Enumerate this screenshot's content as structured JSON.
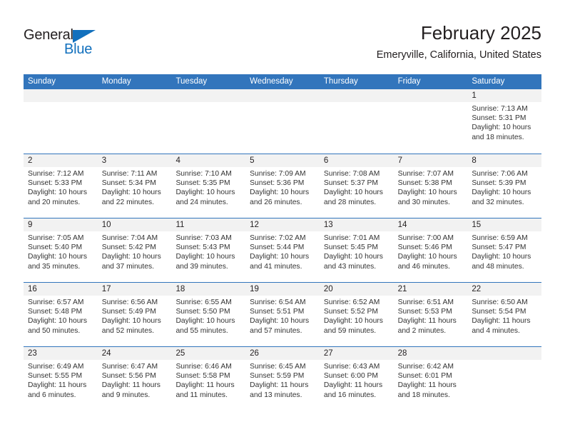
{
  "brand": {
    "name_part1": "General",
    "name_part2": "Blue",
    "triangle_color": "#1270bd"
  },
  "header": {
    "title": "February 2025",
    "subtitle": "Emeryville, California, United States"
  },
  "theme": {
    "header_blue": "#3275bc",
    "day_band_gray": "#f2f2f2",
    "text_color": "#231f20"
  },
  "weekdays": [
    "Sunday",
    "Monday",
    "Tuesday",
    "Wednesday",
    "Thursday",
    "Friday",
    "Saturday"
  ],
  "weeks": [
    [
      {
        "day": "",
        "sunrise": "",
        "sunset": "",
        "daylight": "",
        "empty": true
      },
      {
        "day": "",
        "sunrise": "",
        "sunset": "",
        "daylight": "",
        "empty": true
      },
      {
        "day": "",
        "sunrise": "",
        "sunset": "",
        "daylight": "",
        "empty": true
      },
      {
        "day": "",
        "sunrise": "",
        "sunset": "",
        "daylight": "",
        "empty": true
      },
      {
        "day": "",
        "sunrise": "",
        "sunset": "",
        "daylight": "",
        "empty": true
      },
      {
        "day": "",
        "sunrise": "",
        "sunset": "",
        "daylight": "",
        "empty": true
      },
      {
        "day": "1",
        "sunrise": "Sunrise: 7:13 AM",
        "sunset": "Sunset: 5:31 PM",
        "daylight": "Daylight: 10 hours and 18 minutes.",
        "empty": false
      }
    ],
    [
      {
        "day": "2",
        "sunrise": "Sunrise: 7:12 AM",
        "sunset": "Sunset: 5:33 PM",
        "daylight": "Daylight: 10 hours and 20 minutes.",
        "empty": false
      },
      {
        "day": "3",
        "sunrise": "Sunrise: 7:11 AM",
        "sunset": "Sunset: 5:34 PM",
        "daylight": "Daylight: 10 hours and 22 minutes.",
        "empty": false
      },
      {
        "day": "4",
        "sunrise": "Sunrise: 7:10 AM",
        "sunset": "Sunset: 5:35 PM",
        "daylight": "Daylight: 10 hours and 24 minutes.",
        "empty": false
      },
      {
        "day": "5",
        "sunrise": "Sunrise: 7:09 AM",
        "sunset": "Sunset: 5:36 PM",
        "daylight": "Daylight: 10 hours and 26 minutes.",
        "empty": false
      },
      {
        "day": "6",
        "sunrise": "Sunrise: 7:08 AM",
        "sunset": "Sunset: 5:37 PM",
        "daylight": "Daylight: 10 hours and 28 minutes.",
        "empty": false
      },
      {
        "day": "7",
        "sunrise": "Sunrise: 7:07 AM",
        "sunset": "Sunset: 5:38 PM",
        "daylight": "Daylight: 10 hours and 30 minutes.",
        "empty": false
      },
      {
        "day": "8",
        "sunrise": "Sunrise: 7:06 AM",
        "sunset": "Sunset: 5:39 PM",
        "daylight": "Daylight: 10 hours and 32 minutes.",
        "empty": false
      }
    ],
    [
      {
        "day": "9",
        "sunrise": "Sunrise: 7:05 AM",
        "sunset": "Sunset: 5:40 PM",
        "daylight": "Daylight: 10 hours and 35 minutes.",
        "empty": false
      },
      {
        "day": "10",
        "sunrise": "Sunrise: 7:04 AM",
        "sunset": "Sunset: 5:42 PM",
        "daylight": "Daylight: 10 hours and 37 minutes.",
        "empty": false
      },
      {
        "day": "11",
        "sunrise": "Sunrise: 7:03 AM",
        "sunset": "Sunset: 5:43 PM",
        "daylight": "Daylight: 10 hours and 39 minutes.",
        "empty": false
      },
      {
        "day": "12",
        "sunrise": "Sunrise: 7:02 AM",
        "sunset": "Sunset: 5:44 PM",
        "daylight": "Daylight: 10 hours and 41 minutes.",
        "empty": false
      },
      {
        "day": "13",
        "sunrise": "Sunrise: 7:01 AM",
        "sunset": "Sunset: 5:45 PM",
        "daylight": "Daylight: 10 hours and 43 minutes.",
        "empty": false
      },
      {
        "day": "14",
        "sunrise": "Sunrise: 7:00 AM",
        "sunset": "Sunset: 5:46 PM",
        "daylight": "Daylight: 10 hours and 46 minutes.",
        "empty": false
      },
      {
        "day": "15",
        "sunrise": "Sunrise: 6:59 AM",
        "sunset": "Sunset: 5:47 PM",
        "daylight": "Daylight: 10 hours and 48 minutes.",
        "empty": false
      }
    ],
    [
      {
        "day": "16",
        "sunrise": "Sunrise: 6:57 AM",
        "sunset": "Sunset: 5:48 PM",
        "daylight": "Daylight: 10 hours and 50 minutes.",
        "empty": false
      },
      {
        "day": "17",
        "sunrise": "Sunrise: 6:56 AM",
        "sunset": "Sunset: 5:49 PM",
        "daylight": "Daylight: 10 hours and 52 minutes.",
        "empty": false
      },
      {
        "day": "18",
        "sunrise": "Sunrise: 6:55 AM",
        "sunset": "Sunset: 5:50 PM",
        "daylight": "Daylight: 10 hours and 55 minutes.",
        "empty": false
      },
      {
        "day": "19",
        "sunrise": "Sunrise: 6:54 AM",
        "sunset": "Sunset: 5:51 PM",
        "daylight": "Daylight: 10 hours and 57 minutes.",
        "empty": false
      },
      {
        "day": "20",
        "sunrise": "Sunrise: 6:52 AM",
        "sunset": "Sunset: 5:52 PM",
        "daylight": "Daylight: 10 hours and 59 minutes.",
        "empty": false
      },
      {
        "day": "21",
        "sunrise": "Sunrise: 6:51 AM",
        "sunset": "Sunset: 5:53 PM",
        "daylight": "Daylight: 11 hours and 2 minutes.",
        "empty": false
      },
      {
        "day": "22",
        "sunrise": "Sunrise: 6:50 AM",
        "sunset": "Sunset: 5:54 PM",
        "daylight": "Daylight: 11 hours and 4 minutes.",
        "empty": false
      }
    ],
    [
      {
        "day": "23",
        "sunrise": "Sunrise: 6:49 AM",
        "sunset": "Sunset: 5:55 PM",
        "daylight": "Daylight: 11 hours and 6 minutes.",
        "empty": false
      },
      {
        "day": "24",
        "sunrise": "Sunrise: 6:47 AM",
        "sunset": "Sunset: 5:56 PM",
        "daylight": "Daylight: 11 hours and 9 minutes.",
        "empty": false
      },
      {
        "day": "25",
        "sunrise": "Sunrise: 6:46 AM",
        "sunset": "Sunset: 5:58 PM",
        "daylight": "Daylight: 11 hours and 11 minutes.",
        "empty": false
      },
      {
        "day": "26",
        "sunrise": "Sunrise: 6:45 AM",
        "sunset": "Sunset: 5:59 PM",
        "daylight": "Daylight: 11 hours and 13 minutes.",
        "empty": false
      },
      {
        "day": "27",
        "sunrise": "Sunrise: 6:43 AM",
        "sunset": "Sunset: 6:00 PM",
        "daylight": "Daylight: 11 hours and 16 minutes.",
        "empty": false
      },
      {
        "day": "28",
        "sunrise": "Sunrise: 6:42 AM",
        "sunset": "Sunset: 6:01 PM",
        "daylight": "Daylight: 11 hours and 18 minutes.",
        "empty": false
      },
      {
        "day": "",
        "sunrise": "",
        "sunset": "",
        "daylight": "",
        "empty": true
      }
    ]
  ]
}
